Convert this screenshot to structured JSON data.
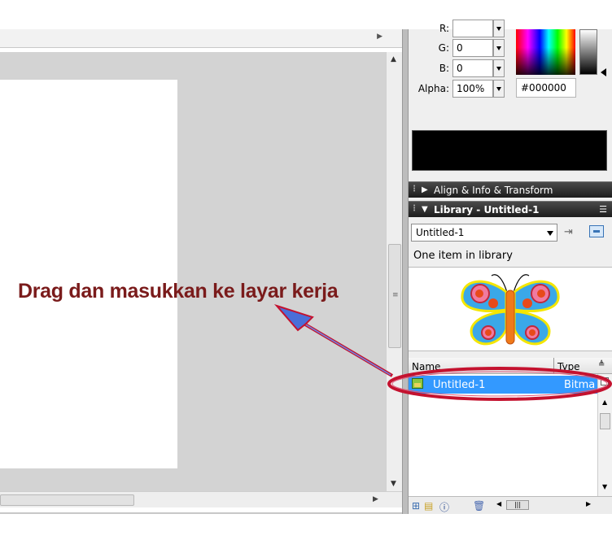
{
  "color_mixer": {
    "r_label": "R:",
    "g_label": "G:",
    "g_value": "0",
    "b_label": "B:",
    "b_value": "0",
    "alpha_label": "Alpha:",
    "alpha_value": "100%",
    "hex_value": "#000000",
    "preview_color": "#000000"
  },
  "panels": {
    "align_info_transform": "Align & Info & Transform",
    "library": "Library - Untitled-1"
  },
  "library": {
    "document_select": "Untitled-1",
    "item_count_text": "One item in library",
    "columns": {
      "name": "Name",
      "type": "Type"
    },
    "items": [
      {
        "name": "Untitled-1",
        "type": "Bitma",
        "icon": "bitmap-icon"
      }
    ],
    "preview_symbol": "butterfly"
  },
  "annotation": {
    "text": "Drag dan masukkan ke layar kerja",
    "color": "#7a1b1b",
    "ellipse_color": "#c4122f",
    "arrow_color": "#4a6ed8"
  },
  "colors": {
    "pasteboard": "#d3d3d3",
    "stage": "#ffffff",
    "selection": "#3399ff",
    "panel_header": "#1c1c1c"
  }
}
